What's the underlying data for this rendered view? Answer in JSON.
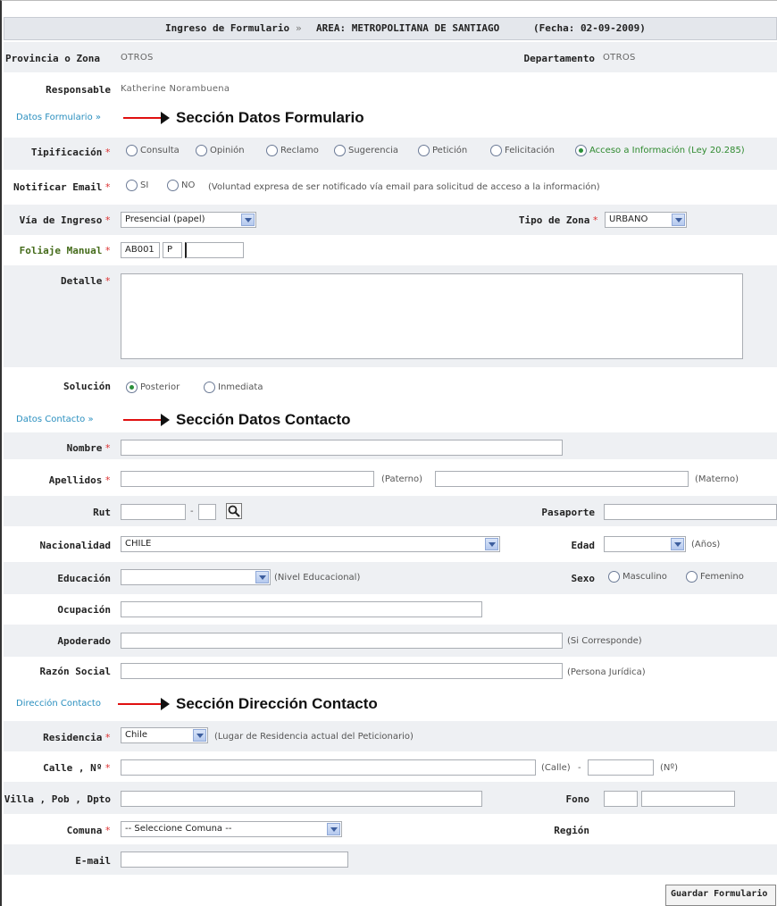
{
  "header": {
    "prefix": "Ingreso de Formulario",
    "separator": "»",
    "area": "AREA: METROPOLITANA DE SANTIAGO",
    "fecha": "(Fecha: 02-09-2009)"
  },
  "info": {
    "provincia_label": "Provincia o Zona",
    "provincia_value": "OTROS",
    "departamento_label": "Departamento",
    "departamento_value": "OTROS",
    "responsable_label": "Responsable",
    "responsable_value": "Katherine Norambuena"
  },
  "sections": {
    "formulario_link": "Datos Formulario »",
    "formulario_title": "Sección Datos Formulario",
    "contacto_link": "Datos Contacto »",
    "contacto_title": "Sección Datos Contacto",
    "direccion_link": "Dirección Contacto",
    "direccion_title": "Sección Dirección Contacto"
  },
  "required_mark": "*",
  "formulario": {
    "tipificacion_label": "Tipificación",
    "tipificacion_options": [
      "Consulta",
      "Opinión",
      "Reclamo",
      "Sugerencia",
      "Petición",
      "Felicitación",
      "Acceso a Información (Ley 20.285)"
    ],
    "tipificacion_selected": "Acceso a Información (Ley 20.285)",
    "notificar_label": "Notificar Email",
    "notificar_options": [
      "SI",
      "NO"
    ],
    "notificar_note": "(Voluntad expresa de ser notificado vía email para solicitud de acceso a la información)",
    "via_label": "Vía de Ingreso",
    "via_value": "Presencial (papel)",
    "tipo_zona_label": "Tipo de Zona",
    "tipo_zona_value": "URBANO",
    "foliaje_label": "Foliaje Manual",
    "foliaje_prefix": "AB001",
    "foliaje_letter": "P",
    "detalle_label": "Detalle",
    "solucion_label": "Solución",
    "solucion_options": [
      "Posterior",
      "Inmediata"
    ],
    "solucion_selected": "Posterior"
  },
  "contacto": {
    "nombre_label": "Nombre",
    "apellidos_label": "Apellidos",
    "paterno_note": "(Paterno)",
    "materno_note": "(Materno)",
    "rut_label": "Rut",
    "rut_separator": "-",
    "pasaporte_label": "Pasaporte",
    "nacionalidad_label": "Nacionalidad",
    "nacionalidad_value": "CHILE",
    "edad_label": "Edad",
    "edad_note": "(Años)",
    "educacion_label": "Educación",
    "educacion_note": "(Nivel Educacional)",
    "sexo_label": "Sexo",
    "sexo_options": [
      "Masculino",
      "Femenino"
    ],
    "ocupacion_label": "Ocupación",
    "apoderado_label": "Apoderado",
    "apoderado_note": "(Si Corresponde)",
    "razon_label": "Razón Social",
    "razon_note": "(Persona Jurídica)"
  },
  "direccion": {
    "residencia_label": "Residencia",
    "residencia_value": "Chile",
    "residencia_note": "(Lugar de Residencia actual del Peticionario)",
    "calle_label": "Calle , Nº",
    "calle_note": "(Calle)",
    "calle_separator": "-",
    "numero_note": "(Nº)",
    "villa_label": "Villa , Pob , Dpto",
    "fono_label": "Fono",
    "comuna_label": "Comuna",
    "comuna_value": "-- Seleccione Comuna --",
    "region_label": "Región",
    "email_label": "E-mail"
  },
  "actions": {
    "guardar_label": "Guardar Formulario"
  }
}
